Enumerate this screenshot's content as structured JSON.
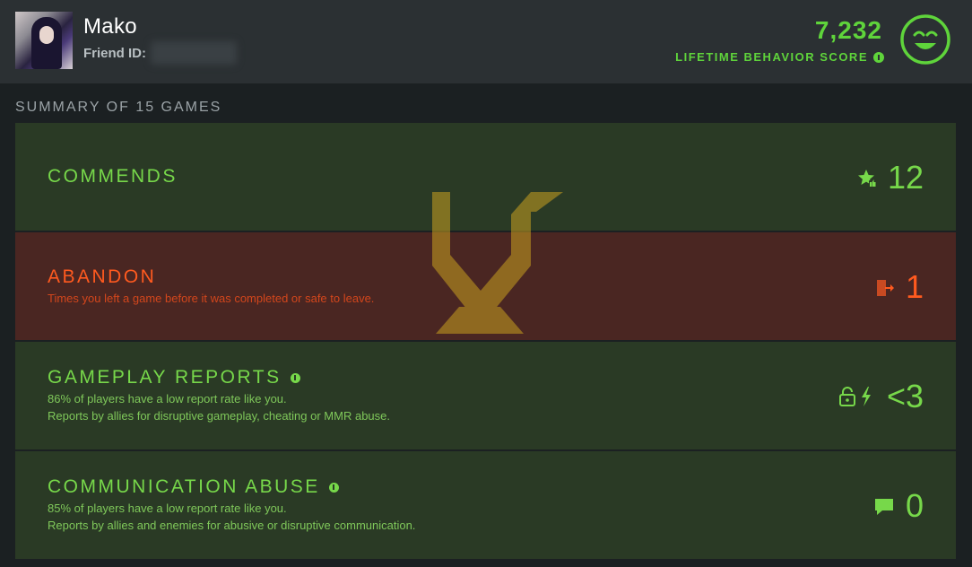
{
  "header": {
    "player_name": "Mako",
    "friend_id_label": "Friend ID:",
    "score_value": "7,232",
    "score_label": "LIFETIME BEHAVIOR SCORE",
    "score_icon": "smiley-icon",
    "accent_color": "#5fd43b"
  },
  "summary": {
    "title": "SUMMARY OF 15 GAMES",
    "rows": [
      {
        "title": "COMMENDS",
        "value": "12",
        "icon": "star-thumb-icon"
      },
      {
        "title": "ABANDON",
        "desc1": "Times you left a game before it was completed or safe to leave.",
        "value": "1",
        "icon": "exit-door-icon",
        "color": "#ff5a1f"
      },
      {
        "title": "GAMEPLAY REPORTS",
        "desc1": "86% of players have a low report rate like you.",
        "desc2": "Reports by allies for disruptive gameplay, cheating or MMR abuse.",
        "value": "<3",
        "icon": "lock-lightning-icon"
      },
      {
        "title": "COMMUNICATION ABUSE",
        "desc1": "85% of players have a low report rate like you.",
        "desc2": "Reports by allies and enemies for abusive or disruptive communication.",
        "value": "0",
        "icon": "chat-bubble-icon"
      }
    ]
  }
}
